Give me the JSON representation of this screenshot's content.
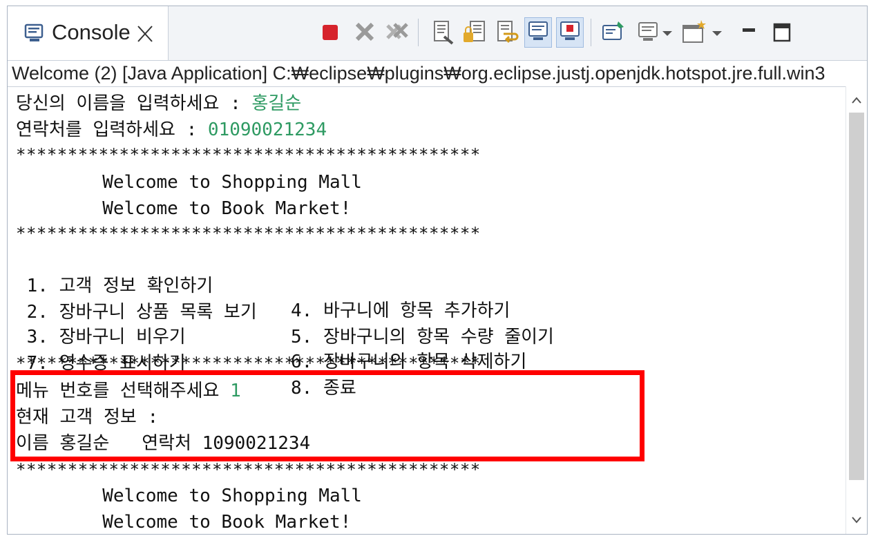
{
  "tab": {
    "label": "Console",
    "close_icon": "close-icon",
    "console_icon": "console-icon"
  },
  "toolbar": {
    "icons": [
      "terminate-icon",
      "remove-launch-icon",
      "remove-all-terminated-icon",
      "clear-console-icon",
      "scroll-lock-icon",
      "word-wrap-icon",
      "show-on-stdout-icon",
      "show-on-stderr-icon",
      "pin-console-icon",
      "display-console-icon",
      "dropdown-arrow-icon",
      "open-console-icon",
      "dropdown-arrow-icon",
      "minimize-icon",
      "maximize-icon"
    ]
  },
  "description": "Welcome (2) [Java Application] C:₩eclipse₩plugins₩org.eclipse.justj.openjdk.hotspot.jre.full.win3",
  "console": {
    "name_prompt": "당신의 이름을 입력하세요 : ",
    "name_value": "홍길순",
    "contact_prompt": "연락처를 입력하세요 : ",
    "contact_value": "01090021234",
    "stars": "*********************************************",
    "welcome1": "        Welcome to Shopping Mall",
    "welcome2": "        Welcome to Book Market!",
    "menu": [
      {
        "left": " 1. 고객 정보 확인하기",
        "right": "4. 바구니에 항목 추가하기"
      },
      {
        "left": " 2. 장바구니 상품 목록 보기",
        "right": "5. 장바구니의 항목 수량 줄이기"
      },
      {
        "left": " 3. 장바구니 비우기",
        "right": "6. 장바구니의 항목 삭제하기"
      },
      {
        "left": " 7. 영수증 표시하기",
        "right": "8. 종료"
      }
    ],
    "menu_prompt": "메뉴 번호를 선택해주세요 ",
    "menu_value": "1",
    "current_info": "현재 고객 정보 :",
    "info_line": "이름 홍길순   연락처 1090021234"
  },
  "colors": {
    "input_green": "#2e9a62",
    "highlight_red": "#ff0000"
  }
}
